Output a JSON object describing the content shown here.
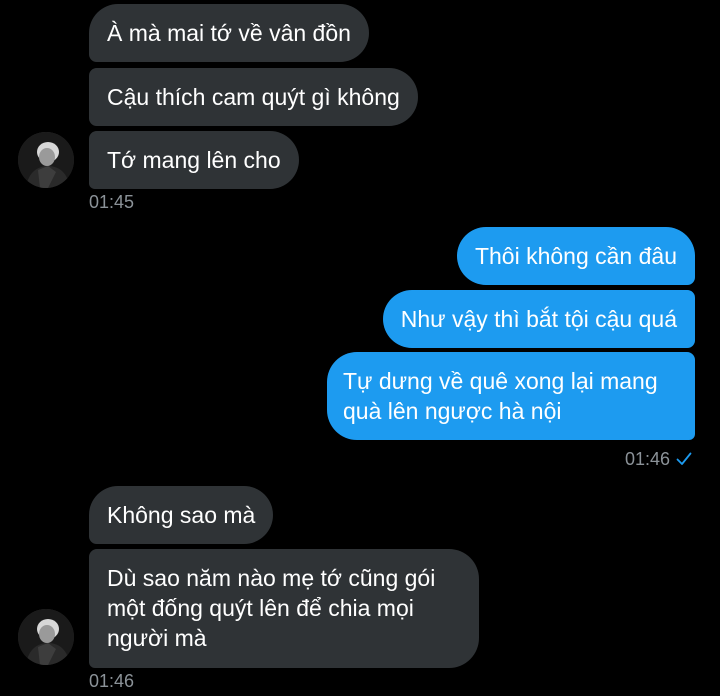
{
  "conversation": {
    "group1": {
      "messages": [
        "À mà mai tớ về vân đồn",
        "Cậu thích cam quýt gì không",
        "Tớ mang lên cho"
      ],
      "time": "01:45"
    },
    "group2": {
      "messages": [
        "Thôi không cần đâu",
        "Như vậy thì bắt tội cậu quá",
        "Tự dưng về quê xong lại mang\nquà lên ngược hà nội"
      ],
      "time": "01:46",
      "status_icon": "read-check-icon"
    },
    "group3": {
      "messages": [
        "Không sao mà",
        "Dù sao năm nào mẹ tớ cũng gói\nmột đống quýt lên để chia mọi\nngười mà"
      ],
      "time": "01:46"
    }
  },
  "colors": {
    "background": "#000000",
    "incoming_bubble": "#2f3336",
    "outgoing_bubble": "#1d9bf0",
    "timestamp": "#8b9298",
    "check": "#1d9bf0"
  }
}
